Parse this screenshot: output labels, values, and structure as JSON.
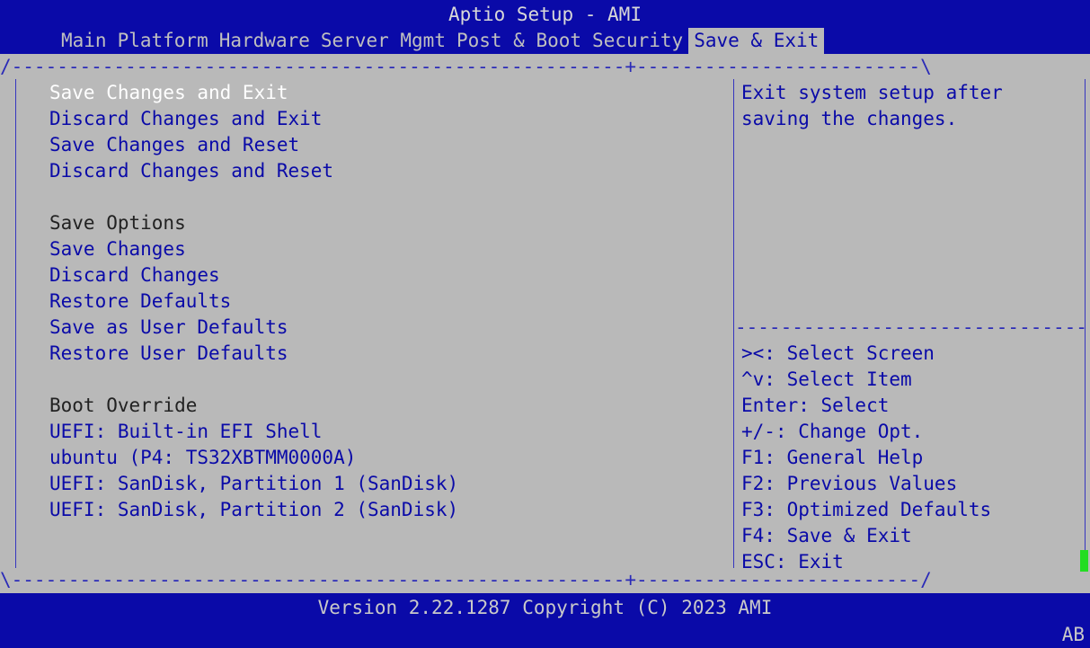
{
  "app": {
    "title": "Aptio Setup - AMI"
  },
  "tabs": [
    {
      "label": "Main"
    },
    {
      "label": "Platform"
    },
    {
      "label": "Hardware"
    },
    {
      "label": "Server Mgmt"
    },
    {
      "label": "Post & Boot"
    },
    {
      "label": "Security"
    },
    {
      "label": "Save & Exit",
      "active": true
    }
  ],
  "menu": {
    "items": [
      {
        "label": "Save Changes and Exit",
        "selected": true
      },
      {
        "label": "Discard Changes and Exit"
      },
      {
        "label": "Save Changes and Reset"
      },
      {
        "label": "Discard Changes and Reset"
      },
      {
        "label": ""
      },
      {
        "label": "Save Options",
        "header": true
      },
      {
        "label": "Save Changes"
      },
      {
        "label": "Discard Changes"
      },
      {
        "label": "Restore Defaults"
      },
      {
        "label": "Save as User Defaults"
      },
      {
        "label": "Restore User Defaults"
      },
      {
        "label": ""
      },
      {
        "label": "Boot Override",
        "header": true
      },
      {
        "label": "UEFI: Built-in EFI Shell"
      },
      {
        "label": "ubuntu (P4: TS32XBTMM0000A)"
      },
      {
        "label": "UEFI: SanDisk, Partition 1 (SanDisk)"
      },
      {
        "label": "UEFI: SanDisk, Partition 2 (SanDisk)"
      }
    ]
  },
  "help": {
    "lines": [
      "Exit system setup after",
      "saving the changes."
    ]
  },
  "keys": {
    "lines": [
      "><: Select Screen",
      "^v: Select Item",
      "Enter: Select",
      "+/-: Change Opt.",
      "F1: General Help",
      "F2: Previous Values",
      "F3: Optimized Defaults",
      "F4: Save & Exit",
      "ESC: Exit"
    ]
  },
  "footer": {
    "version": "Version 2.22.1287 Copyright (C) 2023 AMI",
    "corner": "AB"
  },
  "colors": {
    "bar_blue": "#0a0aa8",
    "panel_gray": "#b9b9b9",
    "item_blue": "#0a0aa8",
    "selected_white": "#ffffff",
    "cursor_green": "#22dd22"
  }
}
